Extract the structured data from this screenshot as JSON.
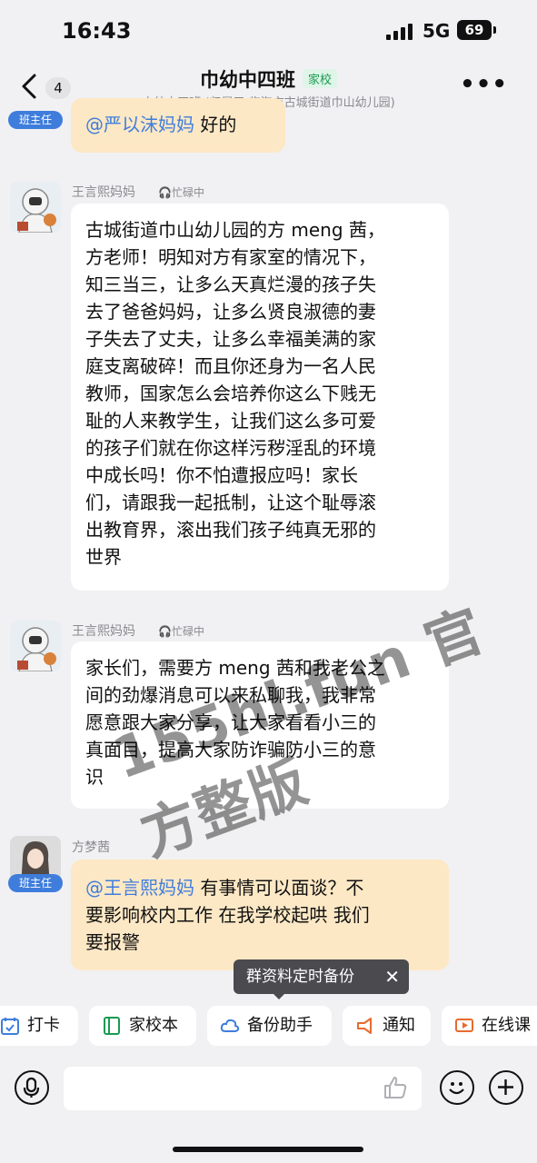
{
  "status_bar": {
    "time": "16:43",
    "network": "5G",
    "battery": "69"
  },
  "header": {
    "back_count": "4",
    "title": "巾幼中四班",
    "title_tag": "家校",
    "subtitle": "巾幼中四班 (归属于 临海市古城街道巾山幼儿园)"
  },
  "messages": [
    {
      "role": "班主任",
      "mention": "@严以沫妈妈",
      "text": " 好的"
    },
    {
      "sender": "王言熙妈妈",
      "status": "忙碌中",
      "text": "古城街道巾山幼儿园的方 meng 茜，\n方老师！明知对方有家室的情况下，\n知三当三，让多么天真烂漫的孩子失\n去了爸爸妈妈，让多么贤良淑德的妻\n子失去了丈夫，让多么幸福美满的家\n庭支离破碎！而且你还身为一名人民\n教师，国家怎么会培养你这么下贱无\n耻的人来教学生，让我们这么多可爱\n的孩子们就在你这样污秽淫乱的环境\n中成长吗！你不怕遭报应吗！家长\n们，请跟我一起抵制，让这个耻辱滚\n出教育界，滚出我们孩子纯真无邪的\n世界"
    },
    {
      "sender": "王言熙妈妈",
      "status": "忙碌中",
      "text": "家长们，需要方 meng 茜和我老公之\n间的劲爆消息可以来私聊我，我非常\n愿意跟大家分享，让大家看看小三的\n真面目，提高大家防诈骗防小三的意\n识"
    },
    {
      "sender": "方梦茜",
      "role": "班主任",
      "mention": "@王言熙妈妈",
      "text": " 有事情可以面谈？不\n要影响校内工作  在我学校起哄  我们\n要报警"
    }
  ],
  "watermark": "155hl.fun 官方整版",
  "tooltip": "群资料定时备份",
  "toolbar": [
    "打卡",
    "家校本",
    "备份助手",
    "通知",
    "在线课"
  ],
  "colors": {
    "accent_blue": "#3f7ddc",
    "bubble_yellow": "#fde8c5",
    "tag_green": "#1a9a52"
  }
}
